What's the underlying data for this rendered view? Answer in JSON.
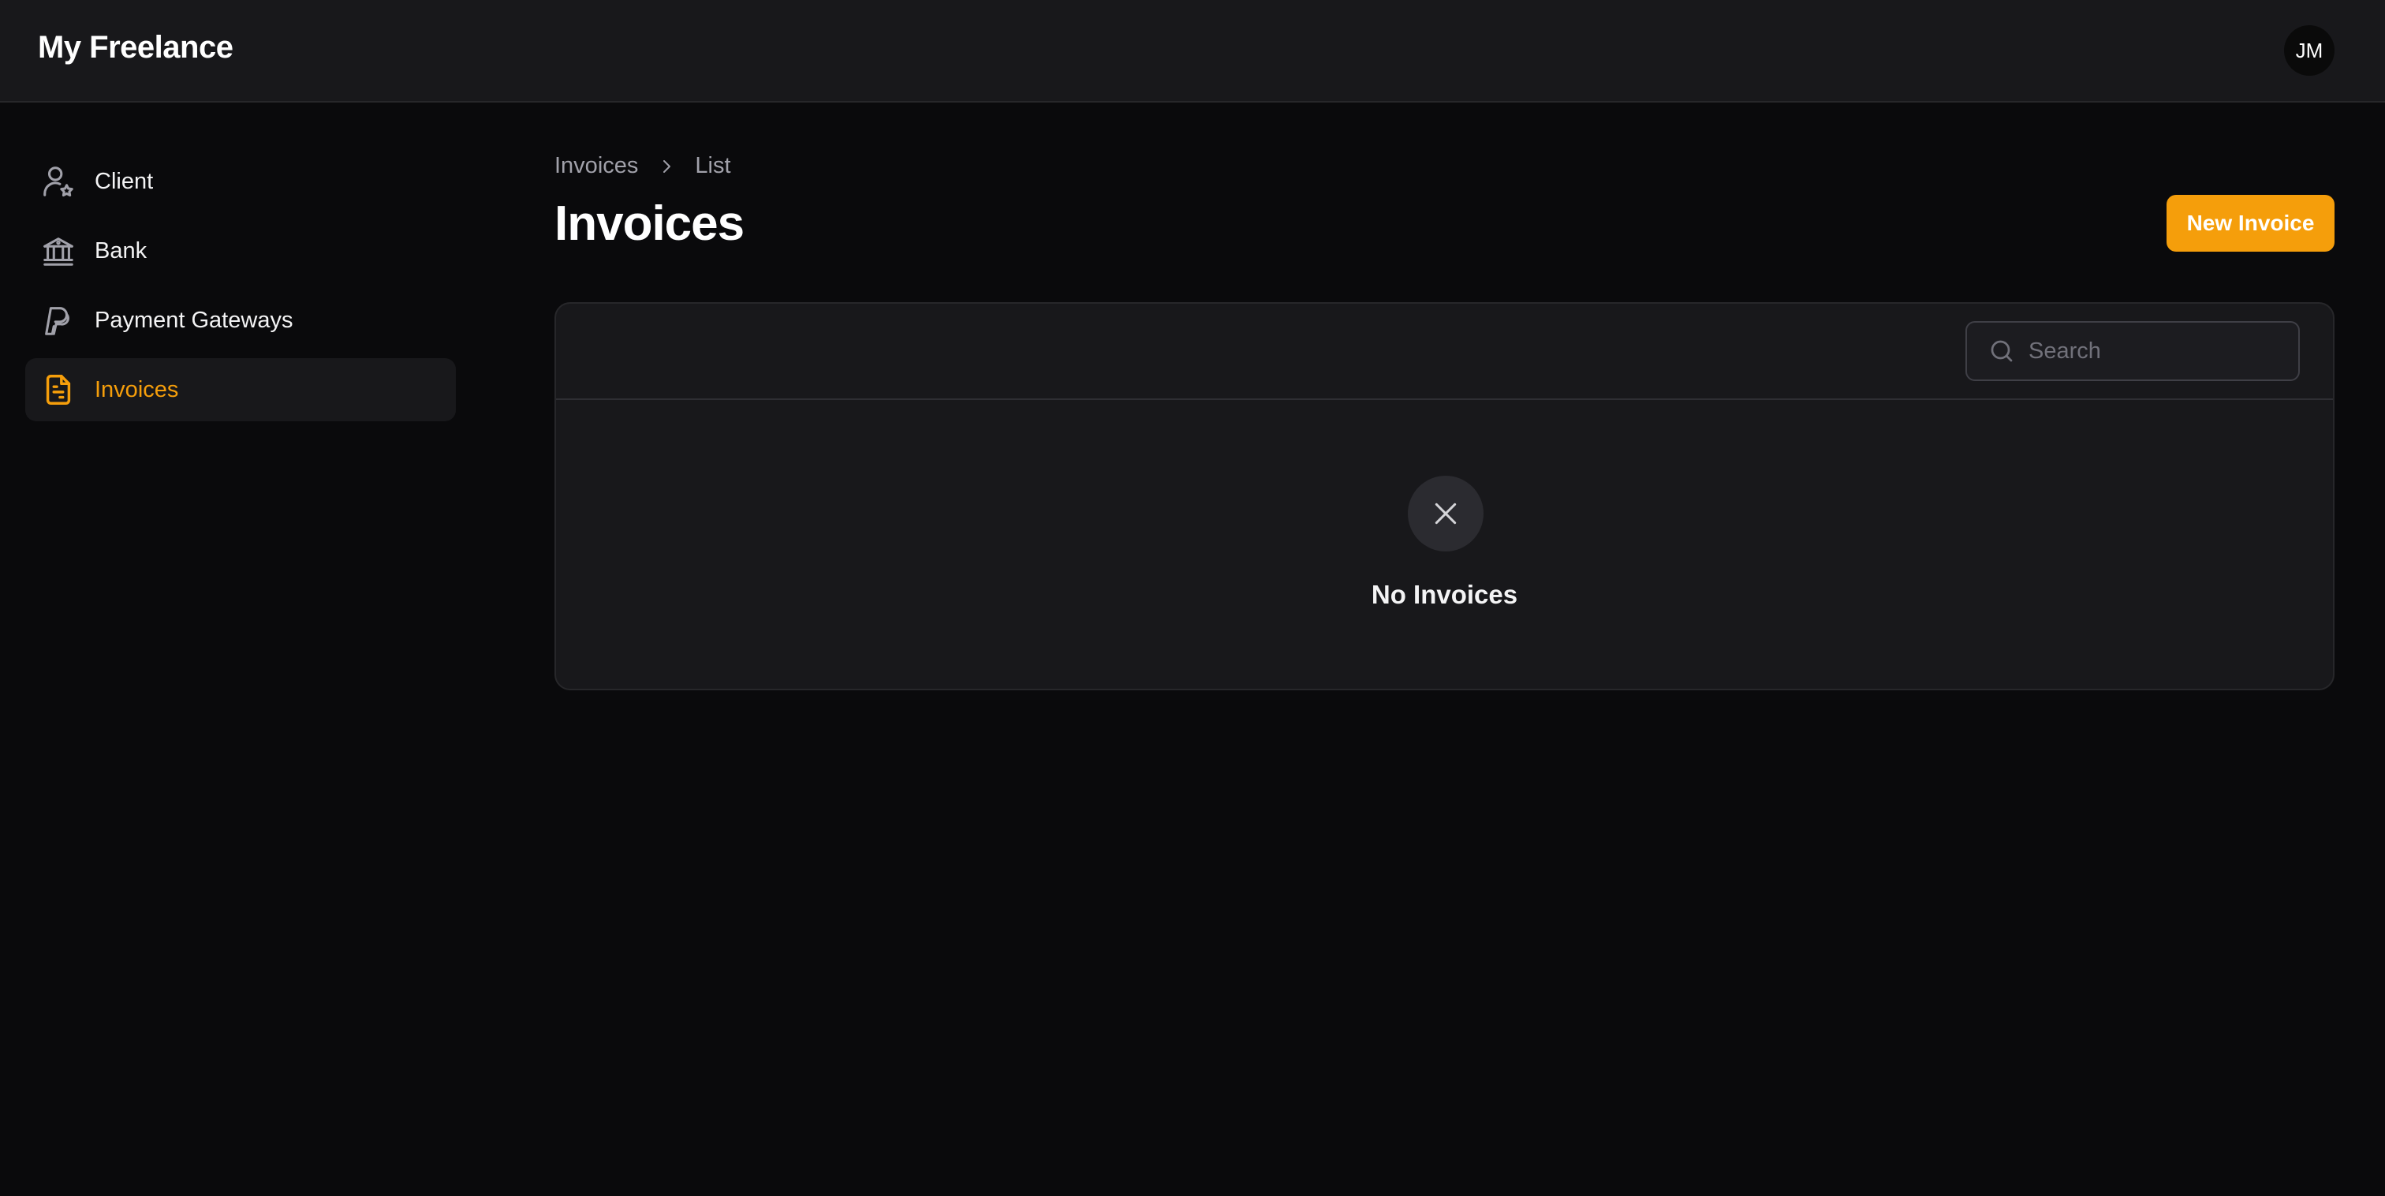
{
  "app": {
    "title": "My Freelance"
  },
  "user": {
    "initials": "JM"
  },
  "sidebar": {
    "items": [
      {
        "label": "Client",
        "icon": "user-star-icon",
        "active": false
      },
      {
        "label": "Bank",
        "icon": "bank-icon",
        "active": false
      },
      {
        "label": "Payment Gateways",
        "icon": "paypal-icon",
        "active": false
      },
      {
        "label": "Invoices",
        "icon": "document-icon",
        "active": true
      }
    ]
  },
  "breadcrumb": {
    "items": [
      "Invoices",
      "List"
    ]
  },
  "page": {
    "title": "Invoices",
    "new_button_label": "New Invoice"
  },
  "table": {
    "search_placeholder": "Search",
    "empty_message": "No Invoices"
  },
  "colors": {
    "accent": "#f59e0b",
    "background": "#0a0a0c",
    "surface": "#18181b"
  }
}
